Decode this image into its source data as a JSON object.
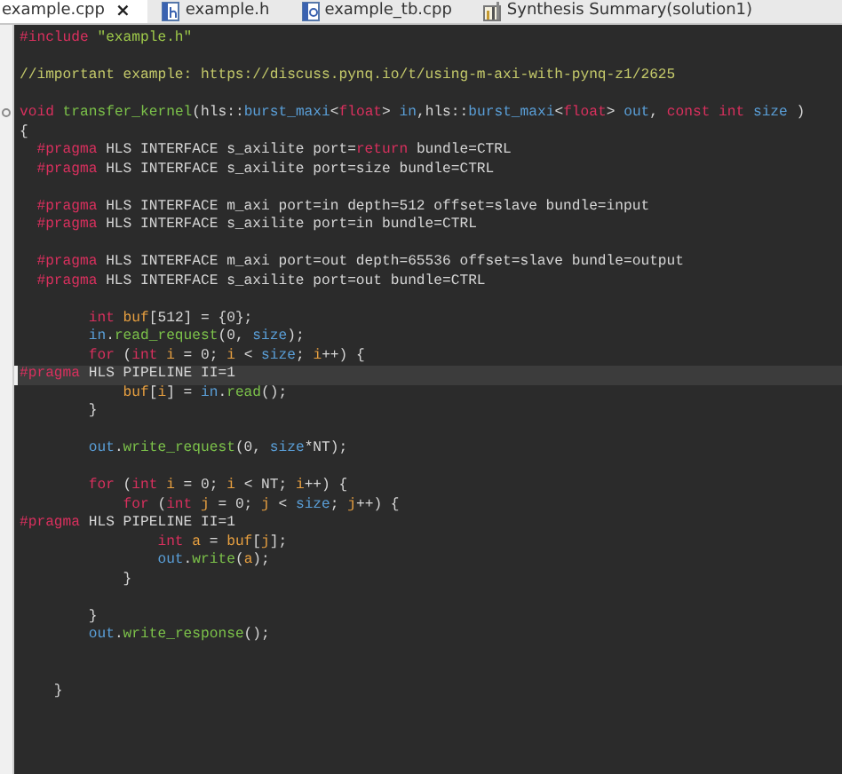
{
  "tabs": [
    {
      "label": "example.cpp",
      "kind": "source",
      "selected": true,
      "closable": true
    },
    {
      "label": "example.h",
      "kind": "header",
      "selected": false
    },
    {
      "label": "example_tb.cpp",
      "kind": "cfile",
      "selected": false
    },
    {
      "label": "Synthesis Summary(solution1)",
      "kind": "report",
      "selected": false
    }
  ],
  "close_symbol": "×",
  "code_lines": [
    {
      "kind": "code",
      "current": false,
      "tokens": [
        {
          "kind": "directive",
          "text": "#include "
        },
        {
          "kind": "string",
          "text": "\"example.h\""
        }
      ]
    },
    {
      "kind": "blank"
    },
    {
      "kind": "code",
      "current": false,
      "tokens": [
        {
          "kind": "comment",
          "text": "//important example: https://discuss.pynq.io/t/using-m-axi-with-pynq-z1/2625"
        }
      ]
    },
    {
      "kind": "blank"
    },
    {
      "kind": "code",
      "current": false,
      "fold": true,
      "tokens": [
        {
          "kind": "keyword",
          "text": "void "
        },
        {
          "kind": "function",
          "text": "transfer_kernel"
        },
        {
          "kind": "plain",
          "text": "(hls::"
        },
        {
          "kind": "type",
          "text": "burst_maxi"
        },
        {
          "kind": "plain",
          "text": "<"
        },
        {
          "kind": "keyword",
          "text": "float"
        },
        {
          "kind": "plain",
          "text": "> "
        },
        {
          "kind": "type",
          "text": "in"
        },
        {
          "kind": "plain",
          "text": ",hls::"
        },
        {
          "kind": "type",
          "text": "burst_maxi"
        },
        {
          "kind": "plain",
          "text": "<"
        },
        {
          "kind": "keyword",
          "text": "float"
        },
        {
          "kind": "plain",
          "text": "> "
        },
        {
          "kind": "type",
          "text": "out"
        },
        {
          "kind": "plain",
          "text": ", "
        },
        {
          "kind": "keyword",
          "text": "const int "
        },
        {
          "kind": "type",
          "text": "size"
        },
        {
          "kind": "plain",
          "text": " )"
        }
      ]
    },
    {
      "kind": "code",
      "current": false,
      "tokens": [
        {
          "kind": "plain",
          "text": "{"
        }
      ]
    },
    {
      "kind": "code",
      "current": false,
      "tokens": [
        {
          "kind": "directive",
          "text": "  #pragma"
        },
        {
          "kind": "plain",
          "text": " HLS INTERFACE s_axilite port="
        },
        {
          "kind": "keyword",
          "text": "return"
        },
        {
          "kind": "plain",
          "text": " bundle=CTRL"
        }
      ]
    },
    {
      "kind": "code",
      "current": false,
      "tokens": [
        {
          "kind": "directive",
          "text": "  #pragma"
        },
        {
          "kind": "plain",
          "text": " HLS INTERFACE s_axilite port=size bundle=CTRL"
        }
      ]
    },
    {
      "kind": "blank"
    },
    {
      "kind": "code",
      "current": false,
      "tokens": [
        {
          "kind": "directive",
          "text": "  #pragma"
        },
        {
          "kind": "plain",
          "text": " HLS INTERFACE m_axi port=in depth=512 offset=slave bundle=input"
        }
      ]
    },
    {
      "kind": "code",
      "current": false,
      "tokens": [
        {
          "kind": "directive",
          "text": "  #pragma"
        },
        {
          "kind": "plain",
          "text": " HLS INTERFACE s_axilite port=in bundle=CTRL"
        }
      ]
    },
    {
      "kind": "blank"
    },
    {
      "kind": "code",
      "current": false,
      "tokens": [
        {
          "kind": "directive",
          "text": "  #pragma"
        },
        {
          "kind": "plain",
          "text": " HLS INTERFACE m_axi port=out depth=65536 offset=slave bundle=output"
        }
      ]
    },
    {
      "kind": "code",
      "current": false,
      "tokens": [
        {
          "kind": "directive",
          "text": "  #pragma"
        },
        {
          "kind": "plain",
          "text": " HLS INTERFACE s_axilite port=out bundle=CTRL"
        }
      ]
    },
    {
      "kind": "blank"
    },
    {
      "kind": "code",
      "current": false,
      "tokens": [
        {
          "kind": "keyword",
          "text": "        int "
        },
        {
          "kind": "variable",
          "text": "buf"
        },
        {
          "kind": "plain",
          "text": "[512] = {0};"
        }
      ]
    },
    {
      "kind": "code",
      "current": false,
      "tokens": [
        {
          "kind": "type",
          "text": "        in"
        },
        {
          "kind": "plain",
          "text": "."
        },
        {
          "kind": "function",
          "text": "read_request"
        },
        {
          "kind": "plain",
          "text": "(0, "
        },
        {
          "kind": "type",
          "text": "size"
        },
        {
          "kind": "plain",
          "text": ");"
        }
      ]
    },
    {
      "kind": "code",
      "current": false,
      "tokens": [
        {
          "kind": "keyword",
          "text": "        for"
        },
        {
          "kind": "plain",
          "text": " ("
        },
        {
          "kind": "keyword",
          "text": "int "
        },
        {
          "kind": "variable",
          "text": "i"
        },
        {
          "kind": "plain",
          "text": " = 0; "
        },
        {
          "kind": "variable",
          "text": "i"
        },
        {
          "kind": "plain",
          "text": " < "
        },
        {
          "kind": "type",
          "text": "size"
        },
        {
          "kind": "plain",
          "text": "; "
        },
        {
          "kind": "variable",
          "text": "i"
        },
        {
          "kind": "plain",
          "text": "++) {"
        }
      ]
    },
    {
      "kind": "code",
      "current": true,
      "tokens": [
        {
          "kind": "directive",
          "text": "#pragma"
        },
        {
          "kind": "plain",
          "text": " HLS PIPELINE II=1"
        }
      ]
    },
    {
      "kind": "code",
      "current": false,
      "tokens": [
        {
          "kind": "variable",
          "text": "            buf"
        },
        {
          "kind": "plain",
          "text": "["
        },
        {
          "kind": "variable",
          "text": "i"
        },
        {
          "kind": "plain",
          "text": "] = "
        },
        {
          "kind": "type",
          "text": "in"
        },
        {
          "kind": "plain",
          "text": "."
        },
        {
          "kind": "function",
          "text": "read"
        },
        {
          "kind": "plain",
          "text": "();"
        }
      ]
    },
    {
      "kind": "code",
      "current": false,
      "tokens": [
        {
          "kind": "plain",
          "text": "        }"
        }
      ]
    },
    {
      "kind": "blank"
    },
    {
      "kind": "code",
      "current": false,
      "tokens": [
        {
          "kind": "type",
          "text": "        out"
        },
        {
          "kind": "plain",
          "text": "."
        },
        {
          "kind": "function",
          "text": "write_request"
        },
        {
          "kind": "plain",
          "text": "(0, "
        },
        {
          "kind": "type",
          "text": "size"
        },
        {
          "kind": "plain",
          "text": "*NT);"
        }
      ]
    },
    {
      "kind": "blank"
    },
    {
      "kind": "code",
      "current": false,
      "tokens": [
        {
          "kind": "keyword",
          "text": "        for"
        },
        {
          "kind": "plain",
          "text": " ("
        },
        {
          "kind": "keyword",
          "text": "int "
        },
        {
          "kind": "variable",
          "text": "i"
        },
        {
          "kind": "plain",
          "text": " = 0; "
        },
        {
          "kind": "variable",
          "text": "i"
        },
        {
          "kind": "plain",
          "text": " < NT; "
        },
        {
          "kind": "variable",
          "text": "i"
        },
        {
          "kind": "plain",
          "text": "++) {"
        }
      ]
    },
    {
      "kind": "code",
      "current": false,
      "tokens": [
        {
          "kind": "keyword",
          "text": "            for"
        },
        {
          "kind": "plain",
          "text": " ("
        },
        {
          "kind": "keyword",
          "text": "int "
        },
        {
          "kind": "variable",
          "text": "j"
        },
        {
          "kind": "plain",
          "text": " = 0; "
        },
        {
          "kind": "variable",
          "text": "j"
        },
        {
          "kind": "plain",
          "text": " < "
        },
        {
          "kind": "type",
          "text": "size"
        },
        {
          "kind": "plain",
          "text": "; "
        },
        {
          "kind": "variable",
          "text": "j"
        },
        {
          "kind": "plain",
          "text": "++) {"
        }
      ]
    },
    {
      "kind": "code",
      "current": false,
      "tokens": [
        {
          "kind": "directive",
          "text": "#pragma"
        },
        {
          "kind": "plain",
          "text": " HLS PIPELINE II=1"
        }
      ]
    },
    {
      "kind": "code",
      "current": false,
      "tokens": [
        {
          "kind": "keyword",
          "text": "                int "
        },
        {
          "kind": "variable",
          "text": "a"
        },
        {
          "kind": "plain",
          "text": " = "
        },
        {
          "kind": "variable",
          "text": "buf"
        },
        {
          "kind": "plain",
          "text": "["
        },
        {
          "kind": "variable",
          "text": "j"
        },
        {
          "kind": "plain",
          "text": "];"
        }
      ]
    },
    {
      "kind": "code",
      "current": false,
      "tokens": [
        {
          "kind": "type",
          "text": "                out"
        },
        {
          "kind": "plain",
          "text": "."
        },
        {
          "kind": "function",
          "text": "write"
        },
        {
          "kind": "plain",
          "text": "("
        },
        {
          "kind": "variable",
          "text": "a"
        },
        {
          "kind": "plain",
          "text": ");"
        }
      ]
    },
    {
      "kind": "code",
      "current": false,
      "tokens": [
        {
          "kind": "plain",
          "text": "            }"
        }
      ]
    },
    {
      "kind": "blank"
    },
    {
      "kind": "code",
      "current": false,
      "tokens": [
        {
          "kind": "plain",
          "text": "        }"
        }
      ]
    },
    {
      "kind": "code",
      "current": false,
      "tokens": [
        {
          "kind": "type",
          "text": "        out"
        },
        {
          "kind": "plain",
          "text": "."
        },
        {
          "kind": "function",
          "text": "write_response"
        },
        {
          "kind": "plain",
          "text": "();"
        }
      ]
    },
    {
      "kind": "blank"
    },
    {
      "kind": "blank"
    },
    {
      "kind": "code",
      "current": false,
      "tokens": [
        {
          "kind": "plain",
          "text": "    }"
        }
      ]
    }
  ]
}
